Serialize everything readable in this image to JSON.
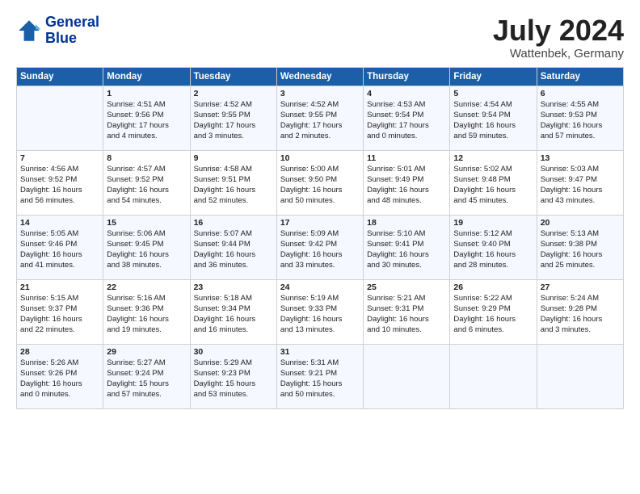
{
  "header": {
    "logo_line1": "General",
    "logo_line2": "Blue",
    "month": "July 2024",
    "location": "Wattenbek, Germany"
  },
  "days_of_week": [
    "Sunday",
    "Monday",
    "Tuesday",
    "Wednesday",
    "Thursday",
    "Friday",
    "Saturday"
  ],
  "weeks": [
    [
      {
        "day": "",
        "content": ""
      },
      {
        "day": "1",
        "content": "Sunrise: 4:51 AM\nSunset: 9:56 PM\nDaylight: 17 hours\nand 4 minutes."
      },
      {
        "day": "2",
        "content": "Sunrise: 4:52 AM\nSunset: 9:55 PM\nDaylight: 17 hours\nand 3 minutes."
      },
      {
        "day": "3",
        "content": "Sunrise: 4:52 AM\nSunset: 9:55 PM\nDaylight: 17 hours\nand 2 minutes."
      },
      {
        "day": "4",
        "content": "Sunrise: 4:53 AM\nSunset: 9:54 PM\nDaylight: 17 hours\nand 0 minutes."
      },
      {
        "day": "5",
        "content": "Sunrise: 4:54 AM\nSunset: 9:54 PM\nDaylight: 16 hours\nand 59 minutes."
      },
      {
        "day": "6",
        "content": "Sunrise: 4:55 AM\nSunset: 9:53 PM\nDaylight: 16 hours\nand 57 minutes."
      }
    ],
    [
      {
        "day": "7",
        "content": "Sunrise: 4:56 AM\nSunset: 9:52 PM\nDaylight: 16 hours\nand 56 minutes."
      },
      {
        "day": "8",
        "content": "Sunrise: 4:57 AM\nSunset: 9:52 PM\nDaylight: 16 hours\nand 54 minutes."
      },
      {
        "day": "9",
        "content": "Sunrise: 4:58 AM\nSunset: 9:51 PM\nDaylight: 16 hours\nand 52 minutes."
      },
      {
        "day": "10",
        "content": "Sunrise: 5:00 AM\nSunset: 9:50 PM\nDaylight: 16 hours\nand 50 minutes."
      },
      {
        "day": "11",
        "content": "Sunrise: 5:01 AM\nSunset: 9:49 PM\nDaylight: 16 hours\nand 48 minutes."
      },
      {
        "day": "12",
        "content": "Sunrise: 5:02 AM\nSunset: 9:48 PM\nDaylight: 16 hours\nand 45 minutes."
      },
      {
        "day": "13",
        "content": "Sunrise: 5:03 AM\nSunset: 9:47 PM\nDaylight: 16 hours\nand 43 minutes."
      }
    ],
    [
      {
        "day": "14",
        "content": "Sunrise: 5:05 AM\nSunset: 9:46 PM\nDaylight: 16 hours\nand 41 minutes."
      },
      {
        "day": "15",
        "content": "Sunrise: 5:06 AM\nSunset: 9:45 PM\nDaylight: 16 hours\nand 38 minutes."
      },
      {
        "day": "16",
        "content": "Sunrise: 5:07 AM\nSunset: 9:44 PM\nDaylight: 16 hours\nand 36 minutes."
      },
      {
        "day": "17",
        "content": "Sunrise: 5:09 AM\nSunset: 9:42 PM\nDaylight: 16 hours\nand 33 minutes."
      },
      {
        "day": "18",
        "content": "Sunrise: 5:10 AM\nSunset: 9:41 PM\nDaylight: 16 hours\nand 30 minutes."
      },
      {
        "day": "19",
        "content": "Sunrise: 5:12 AM\nSunset: 9:40 PM\nDaylight: 16 hours\nand 28 minutes."
      },
      {
        "day": "20",
        "content": "Sunrise: 5:13 AM\nSunset: 9:38 PM\nDaylight: 16 hours\nand 25 minutes."
      }
    ],
    [
      {
        "day": "21",
        "content": "Sunrise: 5:15 AM\nSunset: 9:37 PM\nDaylight: 16 hours\nand 22 minutes."
      },
      {
        "day": "22",
        "content": "Sunrise: 5:16 AM\nSunset: 9:36 PM\nDaylight: 16 hours\nand 19 minutes."
      },
      {
        "day": "23",
        "content": "Sunrise: 5:18 AM\nSunset: 9:34 PM\nDaylight: 16 hours\nand 16 minutes."
      },
      {
        "day": "24",
        "content": "Sunrise: 5:19 AM\nSunset: 9:33 PM\nDaylight: 16 hours\nand 13 minutes."
      },
      {
        "day": "25",
        "content": "Sunrise: 5:21 AM\nSunset: 9:31 PM\nDaylight: 16 hours\nand 10 minutes."
      },
      {
        "day": "26",
        "content": "Sunrise: 5:22 AM\nSunset: 9:29 PM\nDaylight: 16 hours\nand 6 minutes."
      },
      {
        "day": "27",
        "content": "Sunrise: 5:24 AM\nSunset: 9:28 PM\nDaylight: 16 hours\nand 3 minutes."
      }
    ],
    [
      {
        "day": "28",
        "content": "Sunrise: 5:26 AM\nSunset: 9:26 PM\nDaylight: 16 hours\nand 0 minutes."
      },
      {
        "day": "29",
        "content": "Sunrise: 5:27 AM\nSunset: 9:24 PM\nDaylight: 15 hours\nand 57 minutes."
      },
      {
        "day": "30",
        "content": "Sunrise: 5:29 AM\nSunset: 9:23 PM\nDaylight: 15 hours\nand 53 minutes."
      },
      {
        "day": "31",
        "content": "Sunrise: 5:31 AM\nSunset: 9:21 PM\nDaylight: 15 hours\nand 50 minutes."
      },
      {
        "day": "",
        "content": ""
      },
      {
        "day": "",
        "content": ""
      },
      {
        "day": "",
        "content": ""
      }
    ]
  ]
}
